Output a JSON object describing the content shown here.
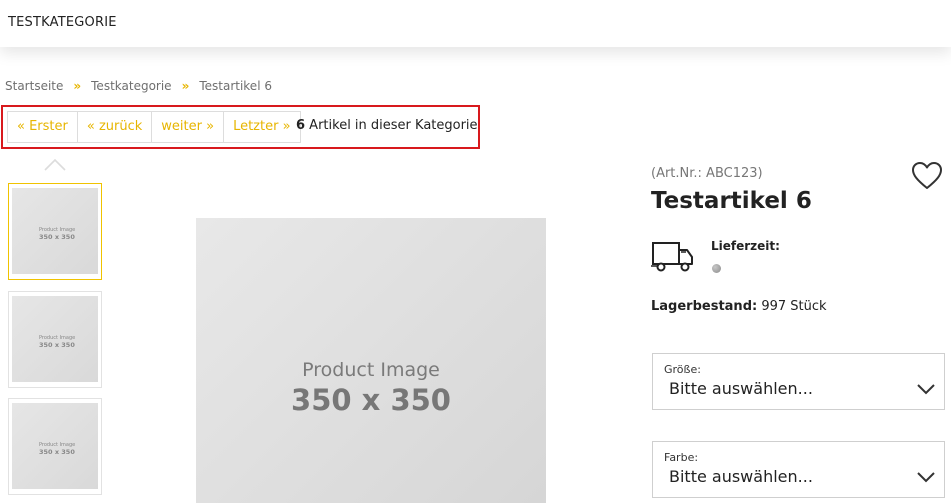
{
  "header": {
    "category": "TESTKATEGORIE"
  },
  "breadcrumb": {
    "items": [
      "Startseite",
      "Testkategorie",
      "Testartikel 6"
    ],
    "separator": "»"
  },
  "pager": {
    "first": "« Erster",
    "prev": "« zurück",
    "next": "weiter »",
    "last": "Letzter »",
    "count": "6",
    "count_text": " Artikel in dieser Kategorie"
  },
  "thumbnails": [
    {
      "line1": "Product Image",
      "line2": "350 x 350",
      "active": true
    },
    {
      "line1": "Product Image",
      "line2": "350 x 350",
      "active": false
    },
    {
      "line1": "Product Image",
      "line2": "350 x 350",
      "active": false
    }
  ],
  "main_image": {
    "line1": "Product Image",
    "line2": "350 x 350"
  },
  "product": {
    "art_nr": "(Art.Nr.: ABC123)",
    "title": "Testartikel 6",
    "delivery_label": "Lieferzeit:",
    "stock_label": "Lagerbestand:",
    "stock_value": " 997 Stück"
  },
  "options": [
    {
      "label": "Größe:",
      "value": "Bitte auswählen..."
    },
    {
      "label": "Farbe:",
      "value": "Bitte auswählen..."
    }
  ],
  "icons": {
    "wishlist": "heart-icon",
    "delivery": "truck-icon",
    "availability": "status-dot-icon",
    "dropdown": "chevron-down-icon",
    "thumb_scroll": "chevron-up-icon"
  },
  "colors": {
    "accent": "#e7b500",
    "highlight_border": "#d8191d",
    "availability_dot": "#9a9a9a"
  }
}
